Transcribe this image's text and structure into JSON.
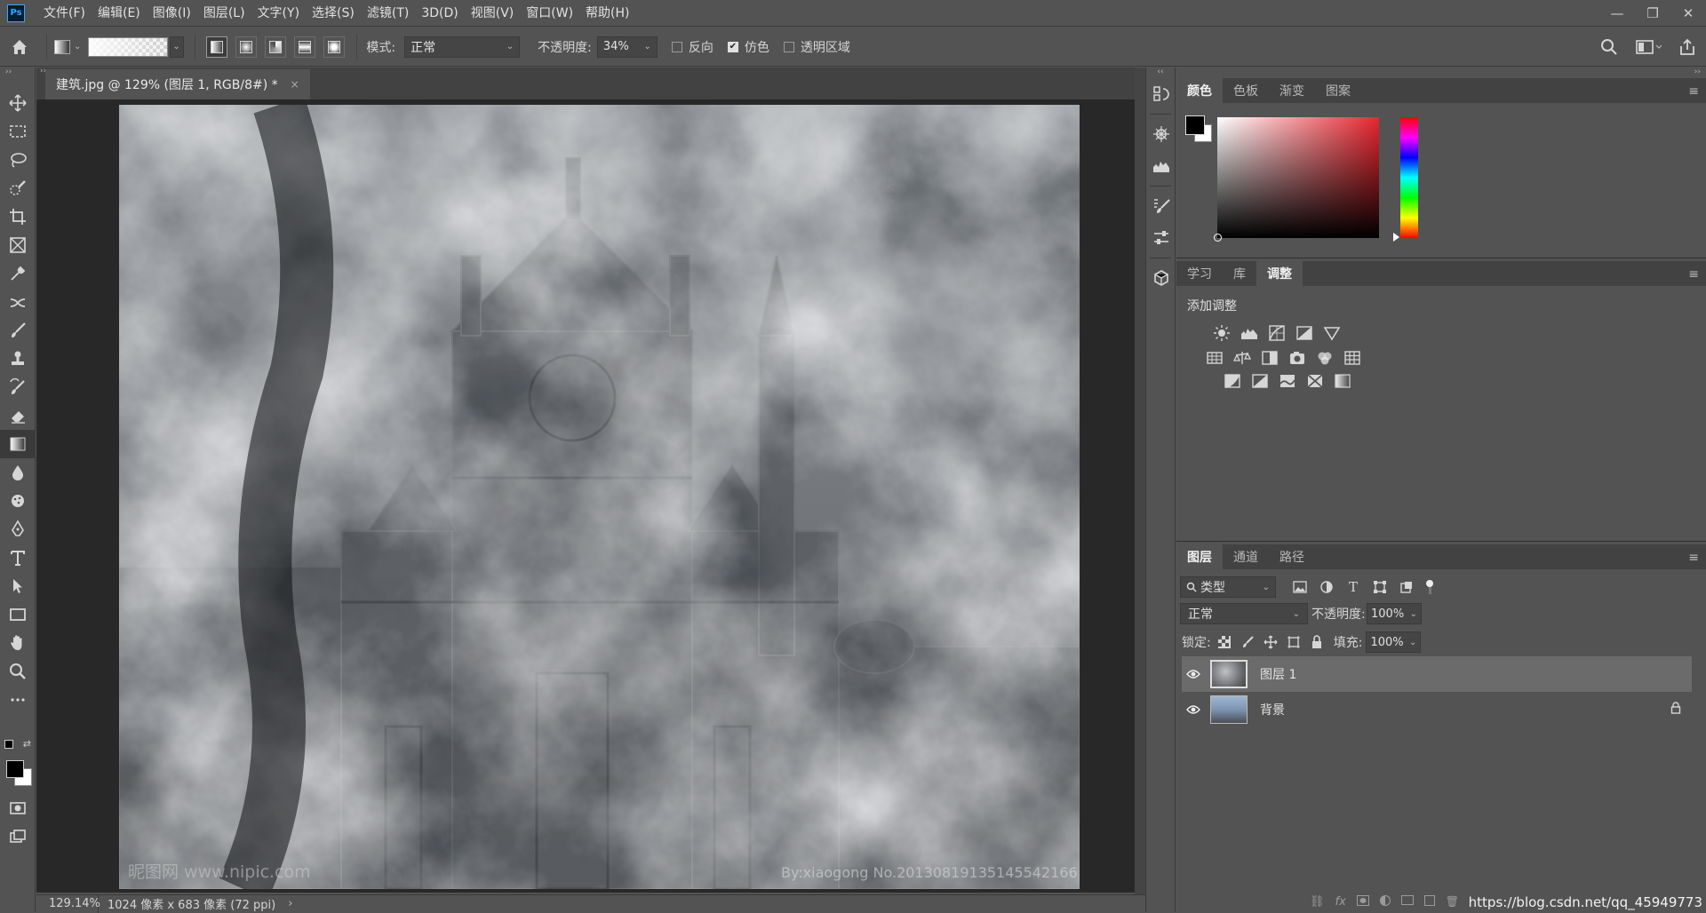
{
  "app": {
    "logo": "Ps"
  },
  "menu": [
    "文件(F)",
    "编辑(E)",
    "图像(I)",
    "图层(L)",
    "文字(Y)",
    "选择(S)",
    "滤镜(T)",
    "3D(D)",
    "视图(V)",
    "窗口(W)",
    "帮助(H)"
  ],
  "window_buttons": {
    "minimize": "—",
    "restore": "❐",
    "close": "✕"
  },
  "options": {
    "mode_label": "模式:",
    "mode_value": "正常",
    "opacity_label": "不透明度:",
    "opacity_value": "34%",
    "reverse_label": "反向",
    "reverse_checked": false,
    "dither_label": "仿色",
    "dither_checked": true,
    "transparency_label": "透明区域",
    "transparency_checked": false
  },
  "document": {
    "tab_title": "建筑.jpg @ 129% (图层 1, RGB/8#) *",
    "close": "×",
    "canvas_watermark_left": "昵图网 www.nipic.com",
    "canvas_watermark_right": "By:xiaogong No.20130819135145542166"
  },
  "status": {
    "zoom": "129.14%",
    "info": "1024 像素 x 683 像素 (72 ppi)",
    "arrow": "›"
  },
  "color_panel": {
    "tabs": [
      "颜色",
      "色板",
      "渐变",
      "图案"
    ],
    "active": 0,
    "foreground": "#000000",
    "background": "#ffffff",
    "hue_color": "#e8262f"
  },
  "adjust_panel": {
    "tabs": [
      "学习",
      "库",
      "调整"
    ],
    "active": 2,
    "title": "添加调整"
  },
  "layers_panel": {
    "tabs": [
      "图层",
      "通道",
      "路径"
    ],
    "active": 0,
    "filter_label": "类型",
    "blend_mode": "正常",
    "opacity_label": "不透明度:",
    "opacity_value": "100%",
    "lock_label": "锁定:",
    "fill_label": "填充:",
    "fill_value": "100%",
    "layers": [
      {
        "name": "图层 1",
        "selected": true,
        "locked": false
      },
      {
        "name": "背景",
        "selected": false,
        "locked": true
      }
    ]
  },
  "screen_watermark": "https://blog.csdn.net/qq_45949773"
}
